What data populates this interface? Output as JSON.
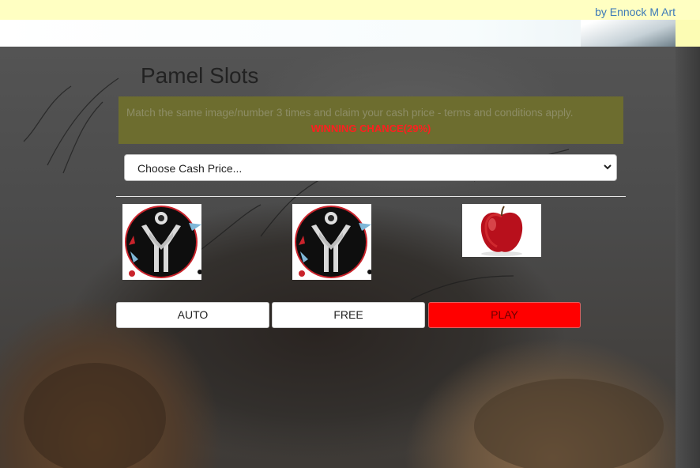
{
  "header": {
    "credit": "by Ennock M Art"
  },
  "app": {
    "title": "Pamel Slots"
  },
  "notice": {
    "message": "Match the same image/number 3 times and claim your cash price - terms and conditions apply.",
    "chance": "WINNING CHANCE(29%)"
  },
  "prize_select": {
    "selected": "Choose Cash Price..."
  },
  "reels": [
    {
      "symbol": "logo-emblem"
    },
    {
      "symbol": "logo-emblem"
    },
    {
      "symbol": "red-apple"
    }
  ],
  "controls": {
    "auto": "AUTO",
    "free": "FREE",
    "play": "PLAY"
  },
  "colors": {
    "notice_bg": "#6d6d2f",
    "chance_text": "#ff1f1f",
    "play_button": "#ff0000",
    "top_banner": "#ffffc2"
  }
}
